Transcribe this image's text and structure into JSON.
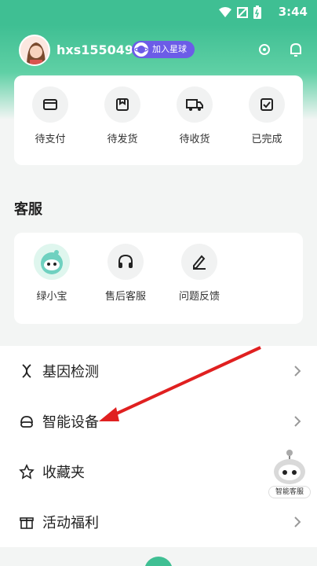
{
  "status": {
    "time": "3:44"
  },
  "header": {
    "username": "hxs155049",
    "badge": "加入星球"
  },
  "orders": [
    {
      "label": "待支付",
      "icon": "wallet-icon"
    },
    {
      "label": "待发货",
      "icon": "box-icon"
    },
    {
      "label": "待收货",
      "icon": "truck-icon"
    },
    {
      "label": "已完成",
      "icon": "check-box-icon"
    }
  ],
  "service": {
    "title": "客服",
    "items": [
      {
        "label": "绿小宝",
        "icon": "robot-avatar"
      },
      {
        "label": "售后客服",
        "icon": "headphones-icon"
      },
      {
        "label": "问题反馈",
        "icon": "pen-icon"
      }
    ]
  },
  "menu": [
    {
      "label": "基因检测",
      "icon": "dna-icon"
    },
    {
      "label": "智能设备",
      "icon": "device-icon"
    },
    {
      "label": "收藏夹",
      "icon": "star-icon"
    },
    {
      "label": "活动福利",
      "icon": "gift-icon"
    }
  ],
  "float": {
    "label": "智能客服"
  },
  "colors": {
    "accent": "#3fbf93",
    "badge": "#6c5ce7",
    "arrow": "#e02020"
  }
}
